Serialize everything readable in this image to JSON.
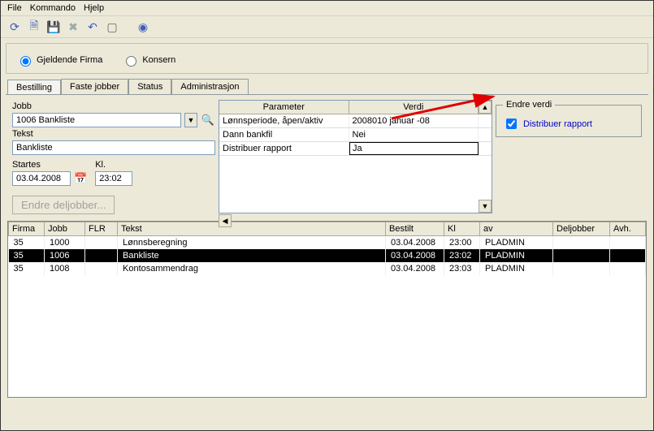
{
  "menu": {
    "file": "File",
    "kommando": "Kommando",
    "hjelp": "Hjelp"
  },
  "radio": {
    "gjeldende": "Gjeldende Firma",
    "konsern": "Konsern"
  },
  "tabs": {
    "bestilling": "Bestilling",
    "faste": "Faste jobber",
    "status": "Status",
    "admin": "Administrasjon"
  },
  "left": {
    "jobb_label": "Jobb",
    "jobb_value": "1006 Bankliste",
    "tekst_label": "Tekst",
    "tekst_value": "Bankliste",
    "startes_label": "Startes",
    "startes_value": "03.04.2008",
    "kl_label": "Kl.",
    "kl_value": "23:02",
    "endre_btn": "Endre deljobber..."
  },
  "param": {
    "col_param": "Parameter",
    "col_verdi": "Verdi",
    "rows": [
      {
        "p": "Lønnsperiode, åpen/aktiv",
        "v": "2008010 januar -08"
      },
      {
        "p": "Dann bankfil",
        "v": "Nei"
      },
      {
        "p": "Distribuer rapport",
        "v": "Ja"
      }
    ]
  },
  "right": {
    "legend": "Endre verdi",
    "chk_label": "Distribuer rapport"
  },
  "grid": {
    "headers": {
      "firma": "Firma",
      "jobb": "Jobb",
      "flr": "FLR",
      "tekst": "Tekst",
      "bestilt": "Bestilt",
      "kl": "Kl",
      "av": "av",
      "deljobber": "Deljobber",
      "avh": "Avh."
    },
    "rows": [
      {
        "firma": "35",
        "jobb": "1000",
        "flr": "",
        "tekst": "Lønnsberegning",
        "bestilt": "03.04.2008",
        "kl": "23:00",
        "av": "PLADMIN",
        "deljobber": "",
        "avh": "",
        "sel": false
      },
      {
        "firma": "35",
        "jobb": "1006",
        "flr": "",
        "tekst": "Bankliste",
        "bestilt": "03.04.2008",
        "kl": "23:02",
        "av": "PLADMIN",
        "deljobber": "",
        "avh": "",
        "sel": true
      },
      {
        "firma": "35",
        "jobb": "1008",
        "flr": "",
        "tekst": "Kontosammendrag",
        "bestilt": "03.04.2008",
        "kl": "23:03",
        "av": "PLADMIN",
        "deljobber": "",
        "avh": "",
        "sel": false
      }
    ]
  }
}
